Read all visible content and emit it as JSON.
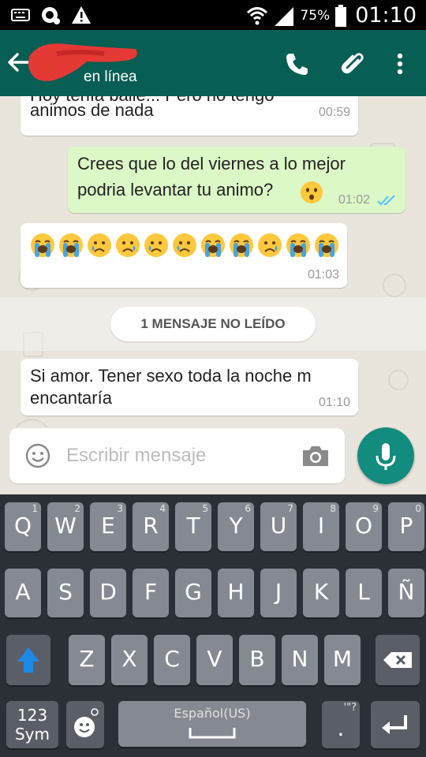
{
  "status_bar": {
    "battery": "75%",
    "time": "01:10"
  },
  "header": {
    "contact_status": "en línea"
  },
  "messages": [
    {
      "dir": "in",
      "lines": [
        "Hoy tenía baile...  Pero no tengo",
        "animos de nada"
      ],
      "time": "00:59"
    },
    {
      "dir": "out",
      "lines": [
        "Crees que lo del viernes a lo mejor",
        "podria levantar tu animo?"
      ],
      "time": "01:02"
    },
    {
      "dir": "in",
      "emoji_sequence": [
        "loudly-crying",
        "loudly-crying",
        "crying",
        "sad-tear",
        "crying",
        "crying",
        "loudly-crying",
        "loudly-crying",
        "sad-tear",
        "loudly-crying",
        "loudly-crying"
      ],
      "time": "01:03"
    },
    {
      "dir": "in",
      "lines": [
        "Si amor. Tener sexo toda la noche m",
        "encantaría"
      ],
      "time": "01:10"
    }
  ],
  "unread_banner": "1 MENSAJE NO LEÍDO",
  "composer": {
    "placeholder": "Escribir mensaje"
  },
  "keyboard": {
    "row1": [
      {
        "k": "Q",
        "n": "1"
      },
      {
        "k": "W",
        "n": "2"
      },
      {
        "k": "E",
        "n": "3"
      },
      {
        "k": "R",
        "n": "4"
      },
      {
        "k": "T",
        "n": "5"
      },
      {
        "k": "Y",
        "n": "6"
      },
      {
        "k": "U",
        "n": "7"
      },
      {
        "k": "I",
        "n": "8"
      },
      {
        "k": "O",
        "n": "9"
      },
      {
        "k": "P",
        "n": "0"
      }
    ],
    "row2": [
      "A",
      "S",
      "D",
      "F",
      "G",
      "H",
      "J",
      "K",
      "L",
      "Ñ"
    ],
    "row3": [
      "Z",
      "X",
      "C",
      "V",
      "B",
      "N",
      "M"
    ],
    "sym_label_1": "123",
    "sym_label_2": "Sym",
    "space_label": "Español(US)",
    "punct_hint": "'\"?",
    "punct_main": "."
  },
  "colors": {
    "header": "#075e54",
    "accent": "#128c7e",
    "outgoing": "#dcf8c6",
    "incoming": "#ffffff",
    "read_ticks": "#4fc3f7"
  },
  "icons": [
    "keyboard-icon",
    "sync-icon",
    "warning-icon",
    "wifi-icon",
    "signal-icon",
    "battery-icon",
    "back-arrow-icon",
    "phone-icon",
    "attach-icon",
    "more-icon",
    "double-check-icon",
    "emoji-icon",
    "camera-icon",
    "mic-icon",
    "shift-icon",
    "backspace-icon",
    "enter-icon",
    "emoji-key-icon"
  ]
}
